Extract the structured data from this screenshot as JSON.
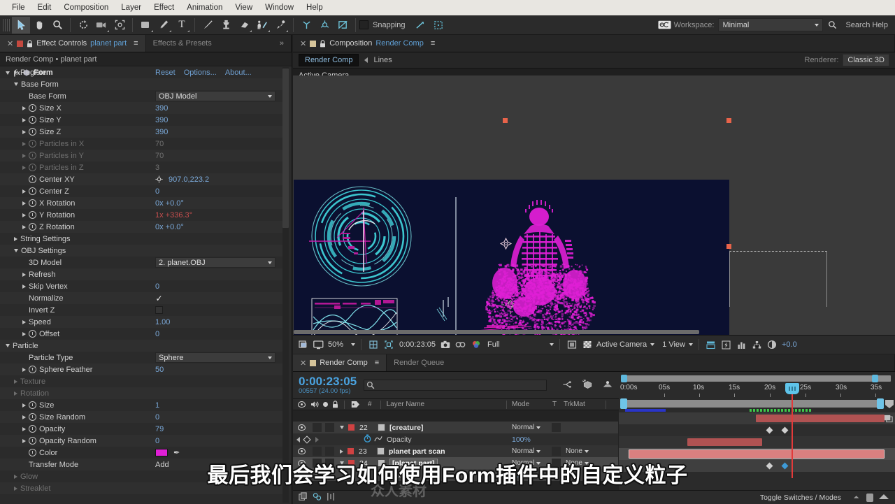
{
  "menubar": {
    "items": [
      "File",
      "Edit",
      "Composition",
      "Layer",
      "Effect",
      "Animation",
      "View",
      "Window",
      "Help"
    ]
  },
  "toolbar": {
    "tools": [
      {
        "name": "selection-tool",
        "glyph": "⬈"
      },
      {
        "name": "hand-tool",
        "glyph": "✋"
      },
      {
        "name": "zoom-tool",
        "glyph": "🔍"
      },
      {
        "name": "rotation-tool",
        "glyph": "↻"
      },
      {
        "name": "camera-tool",
        "glyph": "🎥"
      },
      {
        "name": "pan-behind-tool",
        "glyph": "✥"
      },
      {
        "name": "shape-tool",
        "glyph": "■"
      },
      {
        "name": "pen-tool",
        "glyph": "✒"
      },
      {
        "name": "type-tool",
        "glyph": "T"
      },
      {
        "name": "brush-tool",
        "glyph": "╱"
      },
      {
        "name": "clone-stamp-tool",
        "glyph": "⬤"
      },
      {
        "name": "eraser-tool",
        "glyph": "▱"
      },
      {
        "name": "roto-brush-tool",
        "glyph": "⚘"
      },
      {
        "name": "puppet-pin-tool",
        "glyph": "📌"
      }
    ],
    "snapping_label": "Snapping",
    "snapping_checked": false,
    "workspace_label": "Workspace:",
    "workspace_value": "Minimal",
    "search_help": "Search Help"
  },
  "effect_controls": {
    "tab_label": "Effect Controls",
    "tab_target": "planet part",
    "tab_inactive": "Effects & Presets",
    "breadcrumb": "Render Comp • planet part",
    "effect_title": "Form",
    "actions": [
      "Reset",
      "Options...",
      "About..."
    ],
    "rows": [
      {
        "indent": 1,
        "tri": "right",
        "label": "Register",
        "value": "",
        "kind": "group"
      },
      {
        "indent": 1,
        "tri": "down",
        "label": "Base Form",
        "value": "",
        "kind": "group"
      },
      {
        "indent": 2,
        "tri": "none",
        "label": "Base Form",
        "value": "OBJ Model",
        "kind": "dropdown"
      },
      {
        "indent": 2,
        "tri": "right",
        "sw": true,
        "label": "Size X",
        "value": "390",
        "kind": "num"
      },
      {
        "indent": 2,
        "tri": "right",
        "sw": true,
        "label": "Size Y",
        "value": "390",
        "kind": "num"
      },
      {
        "indent": 2,
        "tri": "right",
        "sw": true,
        "label": "Size Z",
        "value": "390",
        "kind": "num"
      },
      {
        "indent": 2,
        "tri": "right",
        "sw": true,
        "label": "Particles in X",
        "value": "70",
        "kind": "num",
        "disabled": true
      },
      {
        "indent": 2,
        "tri": "right",
        "sw": true,
        "label": "Particles in Y",
        "value": "70",
        "kind": "num",
        "disabled": true
      },
      {
        "indent": 2,
        "tri": "right",
        "sw": true,
        "label": "Particles in Z",
        "value": "3",
        "kind": "num",
        "disabled": true
      },
      {
        "indent": 2,
        "tri": "none",
        "sw": true,
        "label": "Center XY",
        "value": "907.0,223.2",
        "kind": "point"
      },
      {
        "indent": 2,
        "tri": "right",
        "sw": true,
        "label": "Center Z",
        "value": "0",
        "kind": "num"
      },
      {
        "indent": 2,
        "tri": "right",
        "sw": true,
        "label": "X Rotation",
        "value": "0x +0.0°",
        "kind": "num"
      },
      {
        "indent": 2,
        "tri": "right",
        "sw": true,
        "label": "Y Rotation",
        "value": "1x +336.3°",
        "kind": "num-anim"
      },
      {
        "indent": 2,
        "tri": "right",
        "sw": true,
        "label": "Z Rotation",
        "value": "0x +0.0°",
        "kind": "num"
      },
      {
        "indent": 1,
        "tri": "right",
        "label": "String Settings",
        "value": "",
        "kind": "group"
      },
      {
        "indent": 1,
        "tri": "down",
        "label": "OBJ Settings",
        "value": "",
        "kind": "group"
      },
      {
        "indent": 2,
        "tri": "none",
        "label": "3D Model",
        "value": "2. planet.OBJ",
        "kind": "dropdown"
      },
      {
        "indent": 2,
        "tri": "right",
        "label": "Refresh",
        "value": "",
        "kind": "group"
      },
      {
        "indent": 2,
        "tri": "right",
        "label": "Skip Vertex",
        "value": "0",
        "kind": "num"
      },
      {
        "indent": 2,
        "tri": "none",
        "label": "Normalize",
        "value": "✓",
        "kind": "check-on"
      },
      {
        "indent": 2,
        "tri": "none",
        "label": "Invert Z",
        "value": "",
        "kind": "check-off"
      },
      {
        "indent": 2,
        "tri": "right",
        "label": "Speed",
        "value": "1.00",
        "kind": "num"
      },
      {
        "indent": 2,
        "tri": "right",
        "sw": true,
        "label": "Offset",
        "value": "0",
        "kind": "num"
      },
      {
        "indent": 0,
        "tri": "down",
        "label": "Particle",
        "value": "",
        "kind": "group"
      },
      {
        "indent": 2,
        "tri": "none",
        "label": "Particle Type",
        "value": "Sphere",
        "kind": "dropdown"
      },
      {
        "indent": 2,
        "tri": "right",
        "sw": true,
        "label": "Sphere Feather",
        "value": "50",
        "kind": "num"
      },
      {
        "indent": 1,
        "tri": "right",
        "label": "Texture",
        "value": "",
        "kind": "group",
        "disabled": true
      },
      {
        "indent": 1,
        "tri": "right",
        "label": "Rotation",
        "value": "",
        "kind": "group",
        "disabled": true
      },
      {
        "indent": 2,
        "tri": "right",
        "sw": true,
        "label": "Size",
        "value": "1",
        "kind": "num"
      },
      {
        "indent": 2,
        "tri": "right",
        "sw": true,
        "label": "Size Random",
        "value": "0",
        "kind": "num"
      },
      {
        "indent": 2,
        "tri": "right",
        "sw": true,
        "label": "Opacity",
        "value": "79",
        "kind": "num"
      },
      {
        "indent": 2,
        "tri": "right",
        "sw": true,
        "label": "Opacity Random",
        "value": "0",
        "kind": "num"
      },
      {
        "indent": 2,
        "tri": "none",
        "sw": true,
        "label": "Color",
        "value": "",
        "kind": "color",
        "color": "#e01fd6"
      },
      {
        "indent": 2,
        "tri": "none",
        "label": "Transfer Mode",
        "value": "Add",
        "kind": "plaintext"
      },
      {
        "indent": 1,
        "tri": "right",
        "label": "Glow",
        "value": "",
        "kind": "group",
        "disabled": true
      },
      {
        "indent": 1,
        "tri": "right",
        "label": "Streaklet",
        "value": "",
        "kind": "group",
        "disabled": true
      }
    ]
  },
  "composition": {
    "tab_label": "Composition",
    "tab_target": "Render Comp",
    "comp_tab": "Render Comp",
    "comp_tab_2": "Lines",
    "renderer_label": "Renderer:",
    "renderer_value": "Classic 3D",
    "view_label": "Active Camera",
    "footer": {
      "zoom": "50%",
      "timecode": "0:00:23:05",
      "resolution": "Full",
      "camera": "Active Camera",
      "views": "1 View",
      "exposure": "+0.0"
    }
  },
  "timeline": {
    "tab_label": "Render Comp",
    "tab_inactive": "Render Queue",
    "timecode": "0:00:23:05",
    "frames": "00557 (24.00 fps)",
    "columns": {
      "num": "#",
      "layer_name": "Layer Name",
      "mode": "Mode",
      "t": "T",
      "trkmat": "TrkMat"
    },
    "ruler_ticks": [
      "0:00s",
      "05s",
      "10s",
      "15s",
      "20s",
      "25s",
      "30s",
      "35s"
    ],
    "playhead_label": "25s",
    "layers": [
      {
        "type": "layer",
        "index": "22",
        "name": "[creature]",
        "mode": "Normal",
        "trkmat": "",
        "selected": false,
        "expanded": true
      },
      {
        "type": "prop",
        "name": "Opacity",
        "value": "100%",
        "selected": false
      },
      {
        "type": "layer",
        "index": "23",
        "name": "planet part scan",
        "mode": "Normal",
        "trkmat": "None",
        "selected": false,
        "expanded": false
      },
      {
        "type": "layer",
        "index": "24",
        "name": "[planet part]",
        "mode": "Normal",
        "trkmat": "None",
        "selected": true,
        "expanded": true
      },
      {
        "type": "prop",
        "name": "Opacity",
        "value": "0%",
        "selected": true
      }
    ],
    "footer_label": "Toggle Switches / Modes"
  },
  "subtitle": "最后我们会学习如何使用Form插件中的自定义粒子",
  "watermark": "众人素材",
  "colors": {
    "accent_blue": "#4aa3e0",
    "value_blue": "#7aa8d8",
    "animated_red": "#c64e4e",
    "particle_magenta": "#e01fd6",
    "layer_bar_red": "#b05252",
    "hud_cyan": "#3fd0d8"
  }
}
